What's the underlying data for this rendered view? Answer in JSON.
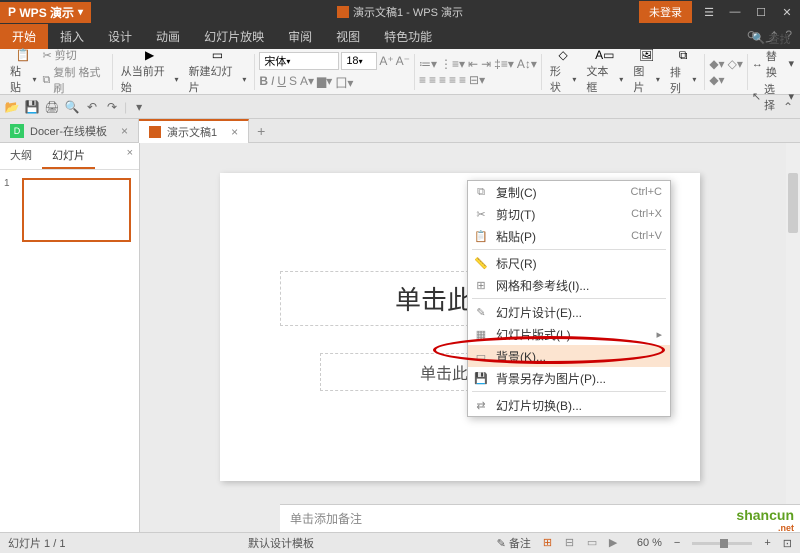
{
  "app": {
    "name": "WPS 演示",
    "title": "演示文稿1 - WPS 演示"
  },
  "login_btn": "未登录",
  "menu": {
    "items": [
      "开始",
      "插入",
      "设计",
      "动画",
      "幻灯片放映",
      "审阅",
      "视图",
      "特色功能"
    ],
    "active": 0
  },
  "ribbon": {
    "paste": "粘贴",
    "cut": "剪切",
    "copy": "复制 格式刷",
    "from_current": "从当前开始",
    "new_slide": "新建幻灯片",
    "font_name": "宋体",
    "font_size": "18",
    "shape": "形状",
    "textbox": "文本框",
    "picture": "图片",
    "arrange": "排列",
    "find": "查找",
    "replace": "替换",
    "select": "选择"
  },
  "doc_tabs": {
    "tab1": "Docer-在线模板",
    "tab2": "演示文稿1"
  },
  "panel": {
    "outline": "大纲",
    "slides": "幻灯片",
    "thumb_num": "1"
  },
  "slide": {
    "title": "单击此处添",
    "subtitle": "单击此处添"
  },
  "context_menu": {
    "copy": "复制(C)",
    "copy_sc": "Ctrl+C",
    "cut": "剪切(T)",
    "cut_sc": "Ctrl+X",
    "paste": "粘贴(P)",
    "paste_sc": "Ctrl+V",
    "ruler": "标尺(R)",
    "grid": "网格和参考线(I)...",
    "design": "幻灯片设计(E)...",
    "format": "幻灯片版式(L)",
    "background": "背景(K)...",
    "save_bg": "背景另存为图片(P)...",
    "transition": "幻灯片切换(B)..."
  },
  "notes": "单击添加备注",
  "status": {
    "page": "幻灯片 1 / 1",
    "template": "默认设计模板",
    "annot": "备注",
    "zoom": "60 %"
  },
  "watermark": {
    "brand": "shancun",
    "suffix": ".net"
  }
}
